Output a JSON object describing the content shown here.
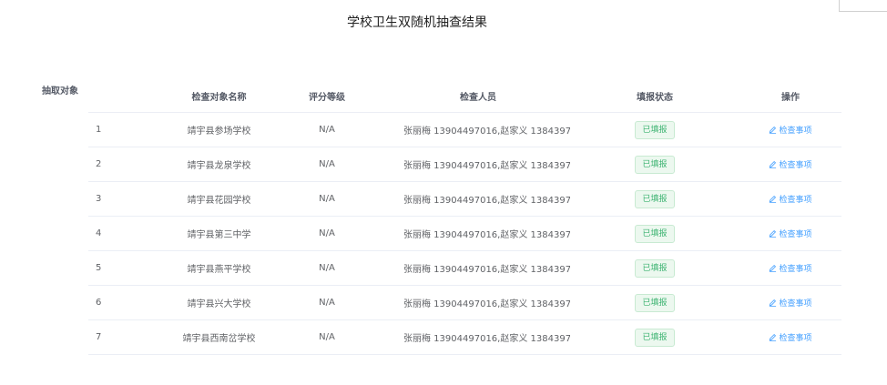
{
  "title": "学校卫生双随机抽查结果",
  "section_label": "抽取对象",
  "columns": {
    "name": "检查对象名称",
    "grade": "评分等级",
    "staff": "检查人员",
    "status": "填报状态",
    "op": "操作"
  },
  "rows": [
    {
      "idx": "1",
      "name": "靖宇县参场学校",
      "grade": "N/A",
      "staff": "张丽梅 13904497016,赵家义 1384397...",
      "status": "已填报",
      "op": "检查事项"
    },
    {
      "idx": "2",
      "name": "靖宇县龙泉学校",
      "grade": "N/A",
      "staff": "张丽梅 13904497016,赵家义 1384397...",
      "status": "已填报",
      "op": "检查事项"
    },
    {
      "idx": "3",
      "name": "靖宇县花园学校",
      "grade": "N/A",
      "staff": "张丽梅 13904497016,赵家义 1384397...",
      "status": "已填报",
      "op": "检查事项"
    },
    {
      "idx": "4",
      "name": "靖宇县第三中学",
      "grade": "N/A",
      "staff": "张丽梅 13904497016,赵家义 1384397...",
      "status": "已填报",
      "op": "检查事项"
    },
    {
      "idx": "5",
      "name": "靖宇县燕平学校",
      "grade": "N/A",
      "staff": "张丽梅 13904497016,赵家义 1384397...",
      "status": "已填报",
      "op": "检查事项"
    },
    {
      "idx": "6",
      "name": "靖宇县兴大学校",
      "grade": "N/A",
      "staff": "张丽梅 13904497016,赵家义 1384397...",
      "status": "已填报",
      "op": "检查事项"
    },
    {
      "idx": "7",
      "name": "靖宇县西南岔学校",
      "grade": "N/A",
      "staff": "张丽梅 13904497016,赵家义 1384397...",
      "status": "已填报",
      "op": "检查事项"
    }
  ],
  "colors": {
    "status_text": "#3cb371",
    "status_bg": "#ecf8ef",
    "link": "#409eff"
  },
  "icons": {
    "op": "edit-icon"
  }
}
